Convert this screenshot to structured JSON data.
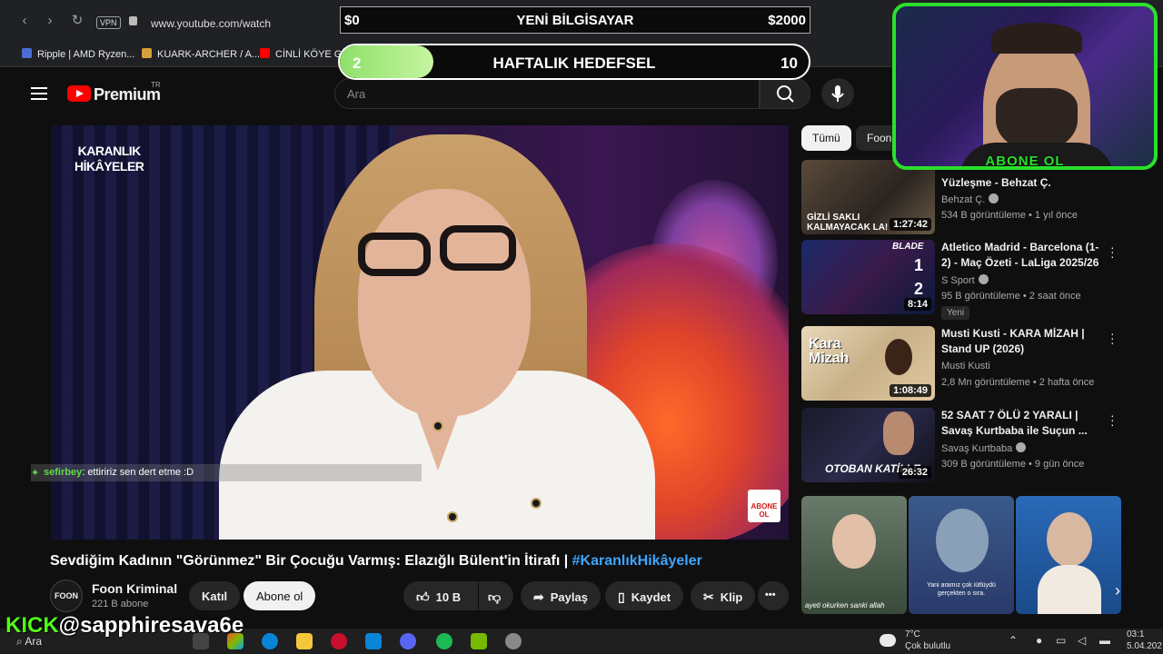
{
  "browser": {
    "url": "www.youtube.com/watch",
    "vpn_label": "VPN",
    "bookmarks": [
      {
        "label": "Ripple | AMD Ryzen...",
        "color": "#4a6ed8"
      },
      {
        "label": "KUARK-ARCHER / A...",
        "color": "#d6a13a"
      },
      {
        "label": "CİNLİ KÖYE GİR",
        "color": "#ff0000"
      }
    ]
  },
  "youtube": {
    "logo_text": "Premium",
    "region": "TR",
    "search_placeholder": "Ara"
  },
  "video": {
    "logo_line1": "KARANLIK",
    "logo_line2": "HİKÂYELER",
    "abone_badge": "ABONE OL",
    "title": "Sevdiğim Kadının \"Görünmez\" Bir Çocuğu Varmış: Elazığlı Bülent'in İtirafı | ",
    "hashtag": "#KaranlıkHikâyeler",
    "channel": {
      "name": "Foon Kriminal",
      "subs": "221 B abone",
      "avatar_text": "FOON"
    },
    "buttons": {
      "join": "Katıl",
      "subscribe": "Abone ol",
      "likes": "10 B",
      "share": "Paylaş",
      "save": "Kaydet",
      "clip": "Klip",
      "more": "•••"
    }
  },
  "chat": {
    "user": "sefirbey",
    "message": ": ettiririz sen dert etme :D"
  },
  "sidebar": {
    "chips": [
      "Tümü",
      "Foon"
    ],
    "recommendations": [
      {
        "title": "Yüzleşme - Behzat Ç.",
        "channel": "Behzat Ç.",
        "verified": true,
        "meta": "534 B görüntüleme • 1 yıl önce",
        "duration": "1:27:42",
        "thumb_text": "GİZLİ SAKLI KALMAYACAK LA!",
        "badge": ""
      },
      {
        "title": "Atletico Madrid - Barcelona (1-2) - Maç Özeti - LaLiga 2025/26",
        "channel": "S Sport",
        "verified": true,
        "meta": "95 B görüntüleme • 2 saat önce",
        "duration": "8:14",
        "thumb_text": "BLADE",
        "badge": "Yeni",
        "score_home": "1",
        "score_away": "2"
      },
      {
        "title": "Musti Kusti - KARA MİZAH | Stand UP (2026)",
        "channel": "Musti Kusti",
        "verified": false,
        "meta": "2,8 Mn görüntüleme • 2 hafta önce",
        "duration": "1:08:49",
        "thumb_text": "Kara Mizah",
        "badge": ""
      },
      {
        "title": "52 SAAT 7 ÖLÜ 2 YARALI | Savaş Kurtbaba ile Suçun ...",
        "channel": "Savaş Kurtbaba",
        "verified": true,
        "meta": "309 B görüntüleme • 9 gün önce",
        "duration": "26:32",
        "thumb_text": "OTOBAN KATİLLE",
        "badge": ""
      }
    ],
    "shorts": [
      {
        "caption": "ayeti okurken sanki allah"
      },
      {
        "caption": "Yani aramız çok iütlüydü gerçekten o sıra."
      },
      {
        "caption": ""
      }
    ]
  },
  "overlay": {
    "goal1": {
      "left": "$0",
      "label": "YENİ BİLGİSAYAR",
      "right": "$2000"
    },
    "goal2": {
      "current": "2",
      "label": "HAFTALIK HEDEFSEL",
      "target": "10",
      "progress": 0.2
    },
    "webcam_label": "ABONE OL",
    "kick_prefix": "KICK",
    "kick_handle": "@sapphiresava6e"
  },
  "taskbar": {
    "search": "Ara",
    "temp": "7°C",
    "weather": "Çok bulutlu",
    "time": "03:1",
    "date": "5.04.202"
  },
  "colors": {
    "accent": "#3ea6ff",
    "webcam_border": "#2be02b",
    "kick_green": "#53fc18",
    "goal_fill": "#8fe06a"
  }
}
